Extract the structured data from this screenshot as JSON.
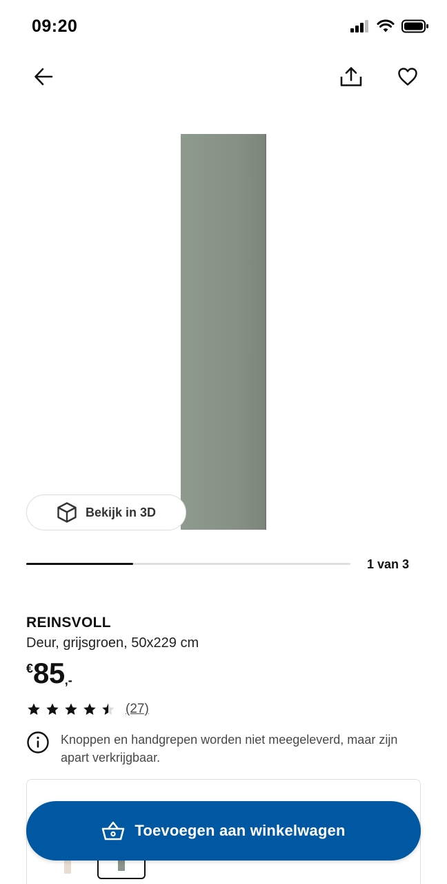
{
  "status_bar": {
    "time": "09:20"
  },
  "nav": {
    "back_icon": "arrow-left-icon",
    "share_icon": "share-icon",
    "favorite_icon": "heart-icon"
  },
  "gallery": {
    "view_3d_label": "Bekijk in 3D",
    "page_indicator": "1 van 3",
    "progress": 0.33,
    "product_color": "#8a9589"
  },
  "product": {
    "name": "REINSVOLL",
    "description": "Deur, grijsgroen, 50x229 cm",
    "price_currency": "€",
    "price_value": "85",
    "price_suffix": ",-",
    "rating": 4.5,
    "rating_max": 5,
    "review_count": "(27)",
    "notice": "Knoppen en handgrepen worden niet meegeleverd, maar zijn apart verkrijgbaar."
  },
  "cart": {
    "label": "Toevoegen aan winkelwagen",
    "color": "#0058a3"
  }
}
